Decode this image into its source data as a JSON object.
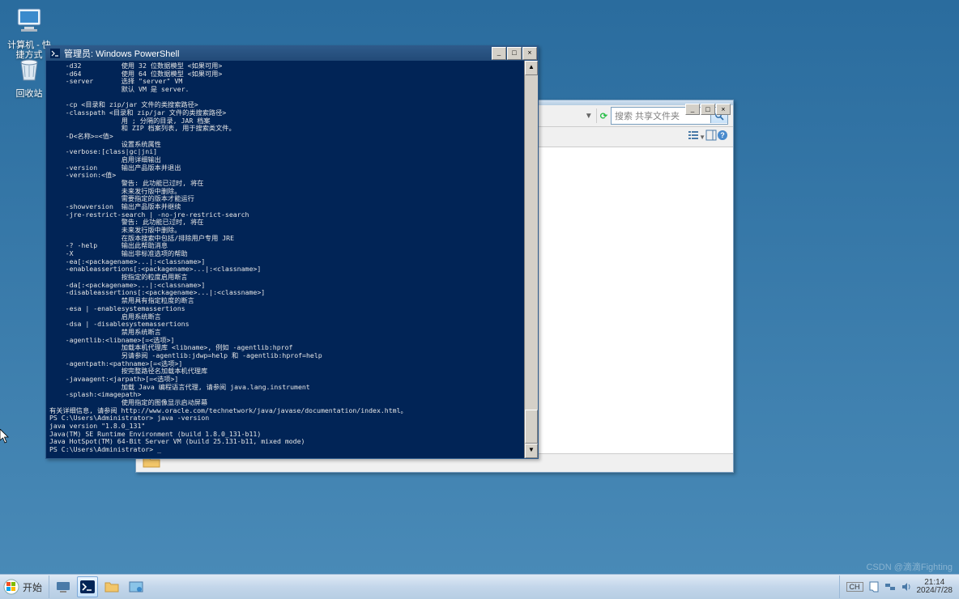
{
  "desktop": {
    "icons": [
      {
        "label": "计算机 - 快\n捷方式",
        "iconName": "computer-icon"
      },
      {
        "label": "回收站",
        "iconName": "recycle-bin-icon"
      }
    ]
  },
  "powershell": {
    "title": "管理员: Windows PowerShell",
    "content": "    -d32          使用 32 位数据模型 <如果可用>\n    -d64          使用 64 位数据模型 <如果可用>\n    -server       选择 \"server\" VM\n                  默认 VM 是 server.\n\n    -cp <目录和 zip/jar 文件的类搜索路径>\n    -classpath <目录和 zip/jar 文件的类搜索路径>\n                  用 ; 分隔的目录, JAR 档案\n                  和 ZIP 档案列表, 用于搜索类文件。\n    -D<名称>=<值>\n                  设置系统属性\n    -verbose:[class|gc|jni]\n                  启用详细输出\n    -version      输出产品版本并退出\n    -version:<值>\n                  警告: 此功能已过时, 将在\n                  未来发行版中删除。\n                  需要指定的版本才能运行\n    -showversion  输出产品版本并继续\n    -jre-restrict-search | -no-jre-restrict-search\n                  警告: 此功能已过时, 将在\n                  未来发行版中删除。\n                  在版本搜索中包括/排除用户专用 JRE\n    -? -help      输出此帮助消息\n    -X            输出非标准选项的帮助\n    -ea[:<packagename>...|:<classname>]\n    -enableassertions[:<packagename>...|:<classname>]\n                  按指定的粒度启用断言\n    -da[:<packagename>...|:<classname>]\n    -disableassertions[:<packagename>...|:<classname>]\n                  禁用具有指定粒度的断言\n    -esa | -enablesystemassertions\n                  启用系统断言\n    -dsa | -disablesystemassertions\n                  禁用系统断言\n    -agentlib:<libname>[=<选项>]\n                  加载本机代理库 <libname>, 例如 -agentlib:hprof\n                  另请参阅 -agentlib:jdwp=help 和 -agentlib:hprof=help\n    -agentpath:<pathname>[=<选项>]\n                  按完整路径名加载本机代理库\n    -javaagent:<jarpath>[=<选项>]\n                  加载 Java 编程语言代理, 请参阅 java.lang.instrument\n    -splash:<imagepath>\n                  使用指定的图像显示启动屏幕\n有关详细信息, 请参阅 http://www.oracle.com/technetwork/java/javase/documentation/index.html。\nPS C:\\Users\\Administrator> java -version\njava version \"1.8.0_131\"\nJava(TM) SE Runtime Environment (build 1.8.0_131-b11)\nJava HotSpot(TM) 64-Bit Server VM (build 25.131-b11, mixed mode)\nPS C:\\Users\\Administrator> _"
  },
  "explorer": {
    "searchPlaceholder": "搜索 共享文件夹"
  },
  "taskbar": {
    "start": "开始",
    "time": "21:14",
    "date": "2024/7/28",
    "trayLang": "CH"
  },
  "watermark": "CSDN @滴滴Fighting",
  "colors": {
    "desktopTop": "#2a6c9e",
    "psBg": "#012456",
    "taskbar": "#c3d6ea"
  }
}
